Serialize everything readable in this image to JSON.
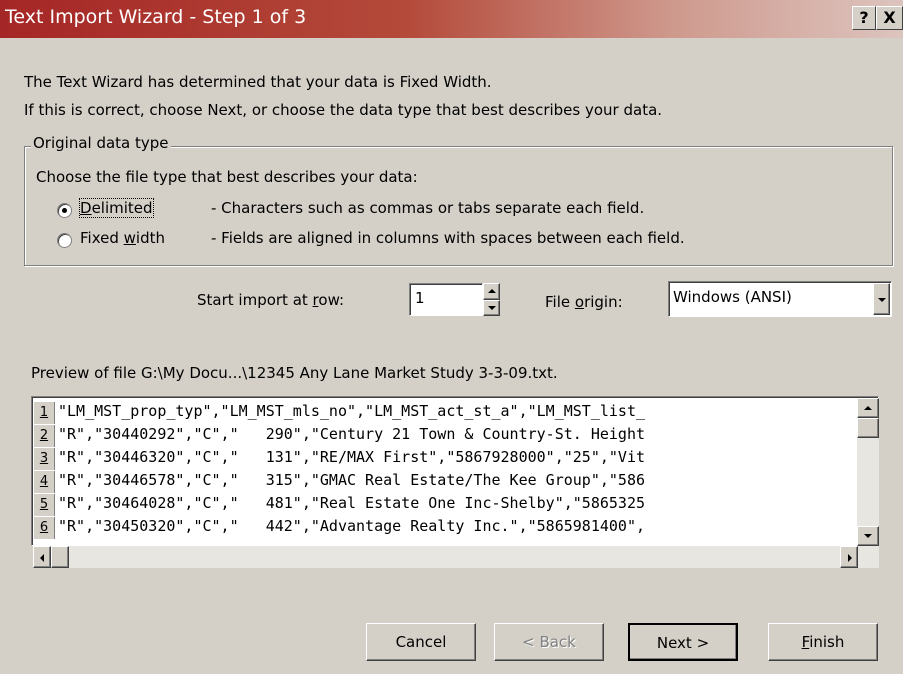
{
  "window": {
    "title": "Text Import Wizard - Step 1 of 3",
    "help_label": "?",
    "close_label": "X"
  },
  "intro": {
    "line1": "The Text Wizard has determined that your data is Fixed Width.",
    "line2": "If this is correct, choose Next, or choose the data type that best describes your data."
  },
  "original_data_type": {
    "legend": "Original data type",
    "prompt": "Choose the file type that best describes your data:",
    "options": [
      {
        "label": "Delimited",
        "description": "- Characters such as commas or tabs separate each field.",
        "checked": true
      },
      {
        "label": "Fixed width",
        "description": "- Fields are aligned in columns with spaces between each field.",
        "checked": false
      }
    ]
  },
  "import_settings": {
    "start_row_label": "Start import at row:",
    "start_row_value": "1",
    "file_origin_label": "File origin:",
    "file_origin_value": "Windows (ANSI)"
  },
  "preview": {
    "label": "Preview of file G:\\My Docu...\\12345 Any Lane Market Study 3-3-09.txt.",
    "rows": [
      {
        "num": "1",
        "text": "\"LM_MST_prop_typ\",\"LM_MST_mls_no\",\"LM_MST_act_st_a\",\"LM_MST_list_"
      },
      {
        "num": "2",
        "text": "\"R\",\"30440292\",\"C\",\"   290\",\"Century 21 Town & Country-St. Height"
      },
      {
        "num": "3",
        "text": "\"R\",\"30446320\",\"C\",\"   131\",\"RE/MAX First\",\"5867928000\",\"25\",\"Vit"
      },
      {
        "num": "4",
        "text": "\"R\",\"30446578\",\"C\",\"   315\",\"GMAC Real Estate/The Kee Group\",\"586"
      },
      {
        "num": "5",
        "text": "\"R\",\"30464028\",\"C\",\"   481\",\"Real Estate One Inc-Shelby\",\"5865325"
      },
      {
        "num": "6",
        "text": "\"R\",\"30450320\",\"C\",\"   442\",\"Advantage Realty Inc.\",\"5865981400\","
      }
    ]
  },
  "buttons": {
    "cancel": "Cancel",
    "back": "< Back",
    "next": "Next >",
    "finish": "Finish"
  },
  "icons": {
    "spinner_up": "spin-up-arrow-icon",
    "spinner_down": "spin-down-arrow-icon",
    "dropdown": "chevron-down-icon"
  }
}
